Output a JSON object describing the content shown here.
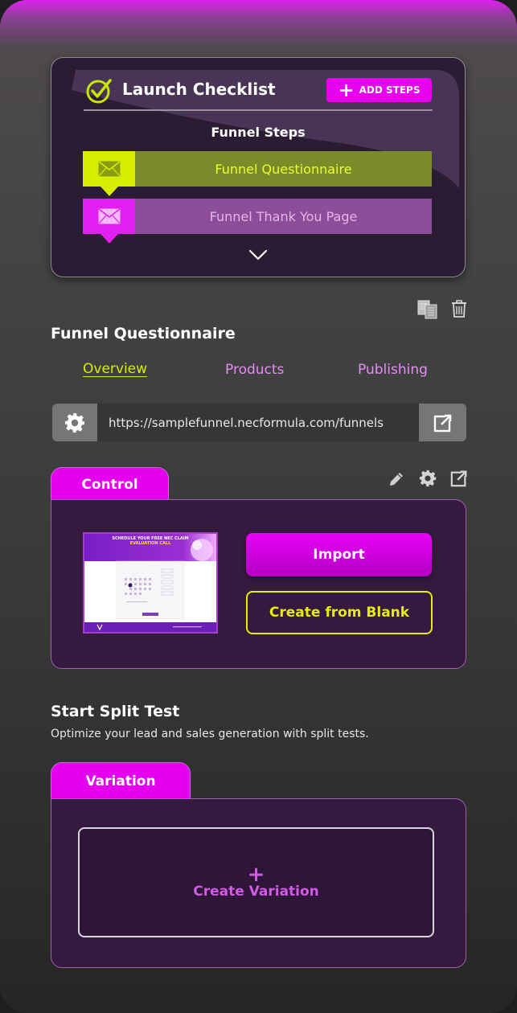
{
  "checklist": {
    "title": "Launch Checklist",
    "add_steps_label": "ADD STEPS",
    "steps_heading": "Funnel Steps",
    "steps": [
      {
        "label": "Funnel Questionnaire",
        "icon": "envelope-icon",
        "color": "#d6ef00"
      },
      {
        "label": "Funnel Thank You Page",
        "icon": "envelope-icon",
        "color": "#e01ff0"
      }
    ],
    "expand_icon": "chevron-down-icon"
  },
  "page_title": "Funnel Questionnaire",
  "tabs": [
    {
      "label": "Overview",
      "active": true
    },
    {
      "label": "Products",
      "active": false
    },
    {
      "label": "Publishing",
      "active": false
    }
  ],
  "url_bar": {
    "url": "https://samplefunnel.necformula.com/funnels",
    "left_icon": "gear-icon",
    "right_icon": "external-link-icon"
  },
  "control": {
    "tab_label": "Control",
    "thumbnail": {
      "headline_line1": "SCHEDULE YOUR FREE NEC CLAIM",
      "headline_line2": "EVALUATION CALL"
    },
    "import_label": "Import",
    "blank_label": "Create from Blank"
  },
  "split_test": {
    "title": "Start Split Test",
    "subtitle": "Optimize your lead and sales generation with split tests.",
    "tab_label": "Variation",
    "create_label": "Create Variation",
    "create_plus": "+"
  },
  "colors": {
    "accent_magenta": "#e600f0",
    "accent_lime": "#d6ef00",
    "panel_bg": "#36193f"
  }
}
